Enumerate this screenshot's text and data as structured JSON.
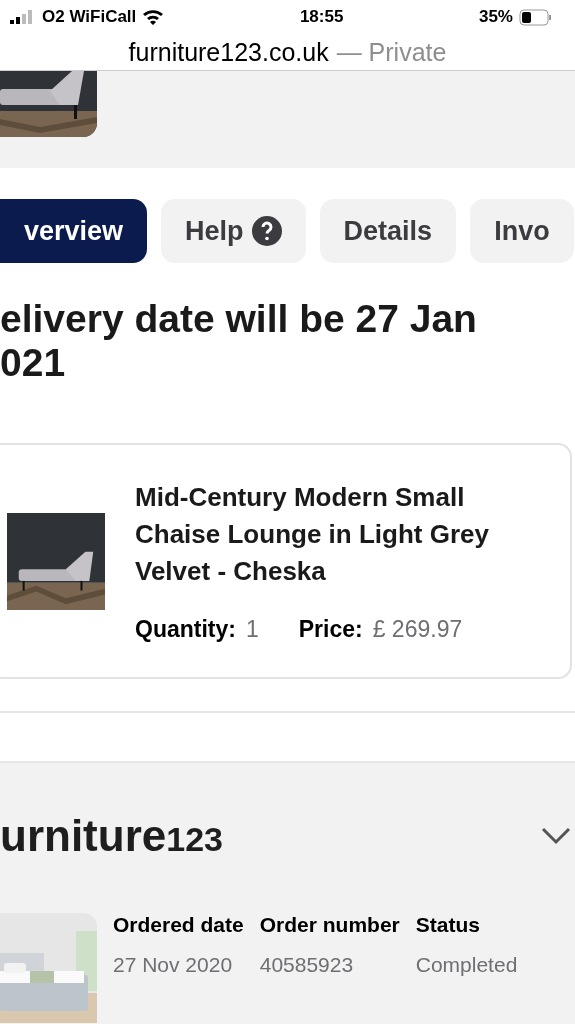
{
  "status_bar": {
    "carrier": "O2 WiFiCall",
    "time": "18:55",
    "battery": "35%"
  },
  "address_bar": {
    "domain": "furniture123.co.uk",
    "suffix": "— Private"
  },
  "tabs": [
    {
      "label": "verview",
      "selected": true,
      "kind": "plain"
    },
    {
      "label": "Help",
      "selected": false,
      "kind": "help"
    },
    {
      "label": "Details",
      "selected": false,
      "kind": "plain"
    },
    {
      "label": "Invo",
      "selected": false,
      "kind": "plain"
    }
  ],
  "delivery_heading": [
    "elivery date will be 27 Jan",
    "021"
  ],
  "product": {
    "name": "Mid-Century Modern Small Chaise Lounge in Light Grey Velvet - Cheska",
    "quantity_label": "Quantity:",
    "quantity": "1",
    "price_label": "Price:",
    "price": "£ 269.97"
  },
  "next_order": {
    "logo": "urniture",
    "logo_number": "123",
    "expanded": false,
    "columns": [
      {
        "label": "Ordered date",
        "value": "27 Nov 2020"
      },
      {
        "label": "Order number",
        "value": "40585923"
      },
      {
        "label": "Status",
        "value": "Completed"
      }
    ]
  }
}
